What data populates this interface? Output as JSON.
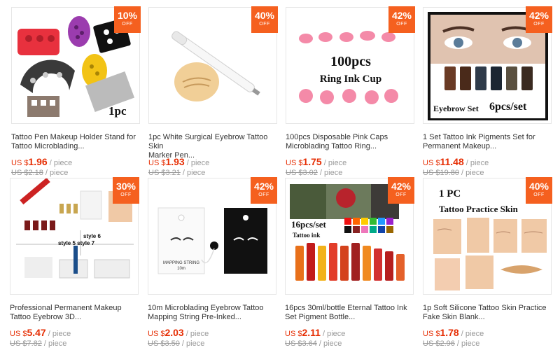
{
  "products": [
    {
      "discount": "10%",
      "off": "OFF",
      "image_caption": "1pc",
      "title_line1": "Tattoo Pen Makeup Holder Stand for",
      "title_line2": "Tattoo Microblading...",
      "currency": "US $",
      "price": "1.96",
      "unit": " / piece",
      "orig_price": "US $2.18",
      "orig_unit": " / piece"
    },
    {
      "discount": "40%",
      "off": "OFF",
      "image_caption": "",
      "title_line1": "1pc White Surgical Eyebrow Tattoo Skin",
      "title_line2": "Marker Pen...",
      "currency": "US $",
      "price": "1.93",
      "unit": " / piece",
      "orig_price": "US $3.21",
      "orig_unit": " / piece"
    },
    {
      "discount": "42%",
      "off": "OFF",
      "image_caption": "100pcs",
      "image_caption2": "Ring Ink Cup",
      "title_line1": "100pcs Disposable Pink Caps",
      "title_line2": "Microblading Tattoo Ring...",
      "currency": "US $",
      "price": "1.75",
      "unit": " / piece",
      "orig_price": "US $3.02",
      "orig_unit": " / piece"
    },
    {
      "discount": "42%",
      "off": "OFF",
      "image_caption": "Eyebrow Set",
      "image_caption2": "6pcs/set",
      "title_line1": "1 Set Tattoo Ink Pigments Set for",
      "title_line2": "Permanent Makeup...",
      "currency": "US $",
      "price": "11.48",
      "unit": " / piece",
      "orig_price": "US $19.80",
      "orig_unit": " / piece"
    },
    {
      "discount": "30%",
      "off": "OFF",
      "image_caption": "style 6",
      "image_caption2": "style 5 style 7",
      "title_line1": "Professional Permanent Makeup",
      "title_line2": "Tattoo Eyebrow 3D...",
      "currency": "US $",
      "price": "5.47",
      "unit": " / piece",
      "orig_price": "US $7.82",
      "orig_unit": " / piece"
    },
    {
      "discount": "42%",
      "off": "OFF",
      "image_caption": "MAPPING STRING",
      "image_caption2": "10m",
      "title_line1": "10m Microblading Eyebrow Tattoo",
      "title_line2": "Mapping String Pre-Inked...",
      "currency": "US $",
      "price": "2.03",
      "unit": " / piece",
      "orig_price": "US $3.50",
      "orig_unit": " / piece"
    },
    {
      "discount": "42%",
      "off": "OFF",
      "image_caption": "16pcs/set",
      "image_caption2": "Tattoo ink",
      "title_line1": "16pcs 30ml/bottle Eternal Tattoo Ink",
      "title_line2": "Set Pigment Bottle...",
      "currency": "US $",
      "price": "2.11",
      "unit": " / piece",
      "orig_price": "US $3.64",
      "orig_unit": " / piece"
    },
    {
      "discount": "40%",
      "off": "OFF",
      "image_caption": "1 PC",
      "image_caption2": "Tattoo Practice Skin",
      "title_line1": "1p Soft Silicone Tattoo Skin Practice",
      "title_line2": "Fake Skin Blank...",
      "currency": "US $",
      "price": "1.78",
      "unit": " / piece",
      "orig_price": "US $2.96",
      "orig_unit": " / piece"
    }
  ],
  "colors": {
    "badge": "#f5601f",
    "price": "#e62e04",
    "muted": "#999999"
  }
}
